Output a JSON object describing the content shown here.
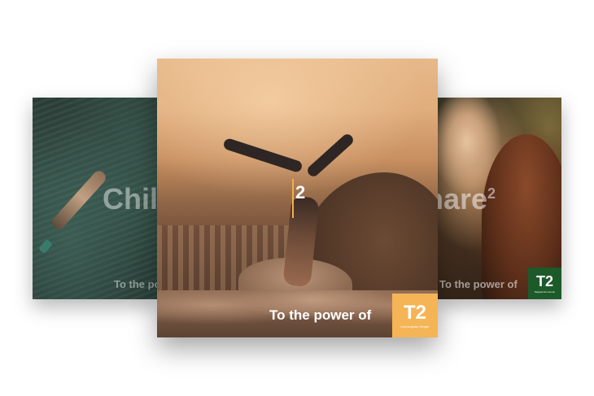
{
  "cards": {
    "left": {
      "headline": "Chill",
      "tagline": "To the power of"
    },
    "center": {
      "number": "2",
      "tagline": "To the power of",
      "logo_mark": "T2",
      "logo_sub": "Lemongrass Ginger"
    },
    "right": {
      "headline": "hare",
      "headline_sup": "2",
      "tagline": "To the power of",
      "logo_mark": "T2",
      "logo_sub": "Peppermint Lemon"
    }
  },
  "colors": {
    "center_logo_bg": "#f5b455",
    "right_logo_bg": "#1d5a2a",
    "accent_line": "#f0b04a"
  }
}
